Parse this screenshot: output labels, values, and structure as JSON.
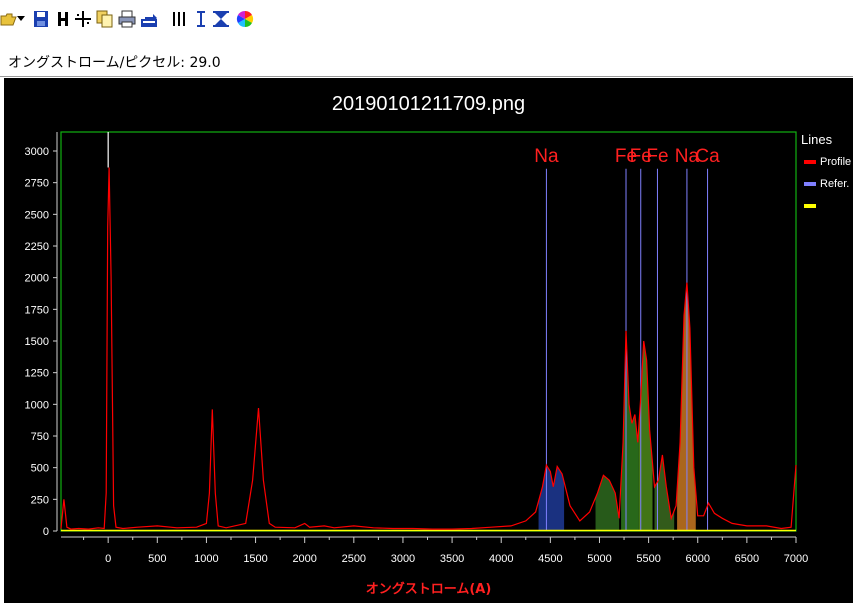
{
  "status": {
    "label": "オングストローム/ピクセル",
    "value": "29.0"
  },
  "toolbar": {
    "items": [
      {
        "name": "open-icon"
      },
      {
        "name": "dropdown-arrow-icon"
      },
      {
        "name": "save-icon"
      },
      {
        "name": "h-icon"
      },
      {
        "name": "crosshair-icon"
      },
      {
        "name": "copy-icon"
      },
      {
        "name": "print-icon"
      },
      {
        "name": "export-icon"
      },
      {
        "name": "columns-icon"
      },
      {
        "name": "vertical-measure-icon"
      },
      {
        "name": "hourglass-icon"
      },
      {
        "name": "color-wheel-icon"
      }
    ]
  },
  "chart_data": {
    "type": "line",
    "title": "20190101211709.png",
    "xlabel": "オングストローム(A)",
    "ylabel": "",
    "xlim": [
      -480,
      7000
    ],
    "ylim": [
      0,
      3150
    ],
    "x_ticks": [
      0,
      500,
      1000,
      1500,
      2000,
      2500,
      3000,
      3500,
      4000,
      4500,
      5000,
      5500,
      6000,
      6500,
      7000
    ],
    "y_ticks": [
      0,
      250,
      500,
      750,
      1000,
      1250,
      1500,
      1750,
      2000,
      2250,
      2500,
      2750,
      3000
    ],
    "legend": {
      "title": "Lines",
      "position": "right",
      "entries": [
        {
          "label": "Profile",
          "color": "#ff0000"
        },
        {
          "label": "Refer.",
          "color": "#8080ff"
        },
        {
          "label": "",
          "color": "#ffff00"
        }
      ]
    },
    "reference_lines": [
      {
        "label": "Na",
        "x": 4460
      },
      {
        "label": "Fe",
        "x": 5270
      },
      {
        "label": "Fe",
        "x": 5420
      },
      {
        "label": "Fe",
        "x": 5590
      },
      {
        "label": "Na",
        "x": 5890
      },
      {
        "label": "Ca",
        "x": 6100
      }
    ],
    "zero_marker_x": 0,
    "series": [
      {
        "name": "Profile",
        "color": "#ff0000",
        "points": [
          [
            -480,
            20
          ],
          [
            -450,
            250
          ],
          [
            -420,
            30
          ],
          [
            -380,
            15
          ],
          [
            -300,
            20
          ],
          [
            -200,
            15
          ],
          [
            -100,
            25
          ],
          [
            -40,
            20
          ],
          [
            -20,
            300
          ],
          [
            -5,
            2400
          ],
          [
            10,
            2870
          ],
          [
            30,
            2000
          ],
          [
            55,
            200
          ],
          [
            80,
            30
          ],
          [
            150,
            20
          ],
          [
            300,
            30
          ],
          [
            500,
            40
          ],
          [
            700,
            25
          ],
          [
            900,
            30
          ],
          [
            1000,
            60
          ],
          [
            1030,
            300
          ],
          [
            1060,
            960
          ],
          [
            1090,
            300
          ],
          [
            1120,
            40
          ],
          [
            1200,
            25
          ],
          [
            1400,
            60
          ],
          [
            1470,
            400
          ],
          [
            1530,
            970
          ],
          [
            1580,
            400
          ],
          [
            1640,
            60
          ],
          [
            1700,
            30
          ],
          [
            1900,
            25
          ],
          [
            2000,
            60
          ],
          [
            2050,
            30
          ],
          [
            2200,
            40
          ],
          [
            2300,
            25
          ],
          [
            2500,
            40
          ],
          [
            2700,
            25
          ],
          [
            2900,
            20
          ],
          [
            3100,
            20
          ],
          [
            3300,
            15
          ],
          [
            3500,
            15
          ],
          [
            3700,
            20
          ],
          [
            3900,
            30
          ],
          [
            4100,
            40
          ],
          [
            4250,
            80
          ],
          [
            4350,
            150
          ],
          [
            4420,
            350
          ],
          [
            4460,
            520
          ],
          [
            4500,
            470
          ],
          [
            4530,
            350
          ],
          [
            4570,
            510
          ],
          [
            4620,
            450
          ],
          [
            4700,
            200
          ],
          [
            4800,
            80
          ],
          [
            4900,
            150
          ],
          [
            4980,
            300
          ],
          [
            5040,
            440
          ],
          [
            5100,
            400
          ],
          [
            5160,
            300
          ],
          [
            5200,
            100
          ],
          [
            5240,
            700
          ],
          [
            5270,
            1580
          ],
          [
            5300,
            1000
          ],
          [
            5330,
            850
          ],
          [
            5360,
            920
          ],
          [
            5390,
            700
          ],
          [
            5420,
            1050
          ],
          [
            5450,
            1500
          ],
          [
            5480,
            1350
          ],
          [
            5510,
            800
          ],
          [
            5560,
            350
          ],
          [
            5600,
            400
          ],
          [
            5640,
            600
          ],
          [
            5680,
            350
          ],
          [
            5730,
            100
          ],
          [
            5780,
            200
          ],
          [
            5820,
            700
          ],
          [
            5860,
            1700
          ],
          [
            5890,
            1960
          ],
          [
            5920,
            1600
          ],
          [
            5960,
            500
          ],
          [
            6000,
            120
          ],
          [
            6060,
            120
          ],
          [
            6110,
            220
          ],
          [
            6170,
            140
          ],
          [
            6250,
            100
          ],
          [
            6350,
            60
          ],
          [
            6500,
            40
          ],
          [
            6700,
            40
          ],
          [
            6850,
            20
          ],
          [
            6950,
            30
          ],
          [
            7000,
            520
          ]
        ]
      }
    ],
    "filled_regions": [
      {
        "range": [
          4380,
          4640
        ],
        "color": "#1e3a96"
      },
      {
        "range": [
          4960,
          5200
        ],
        "color": "#2e6a1e"
      },
      {
        "range": [
          5220,
          5400
        ],
        "color": "#2f7a1e"
      },
      {
        "range": [
          5400,
          5540
        ],
        "color": "#4e8a1a"
      },
      {
        "range": [
          5560,
          5760
        ],
        "color": "#3b6b20"
      },
      {
        "range": [
          5790,
          5980
        ],
        "color": "#c87822"
      }
    ]
  }
}
